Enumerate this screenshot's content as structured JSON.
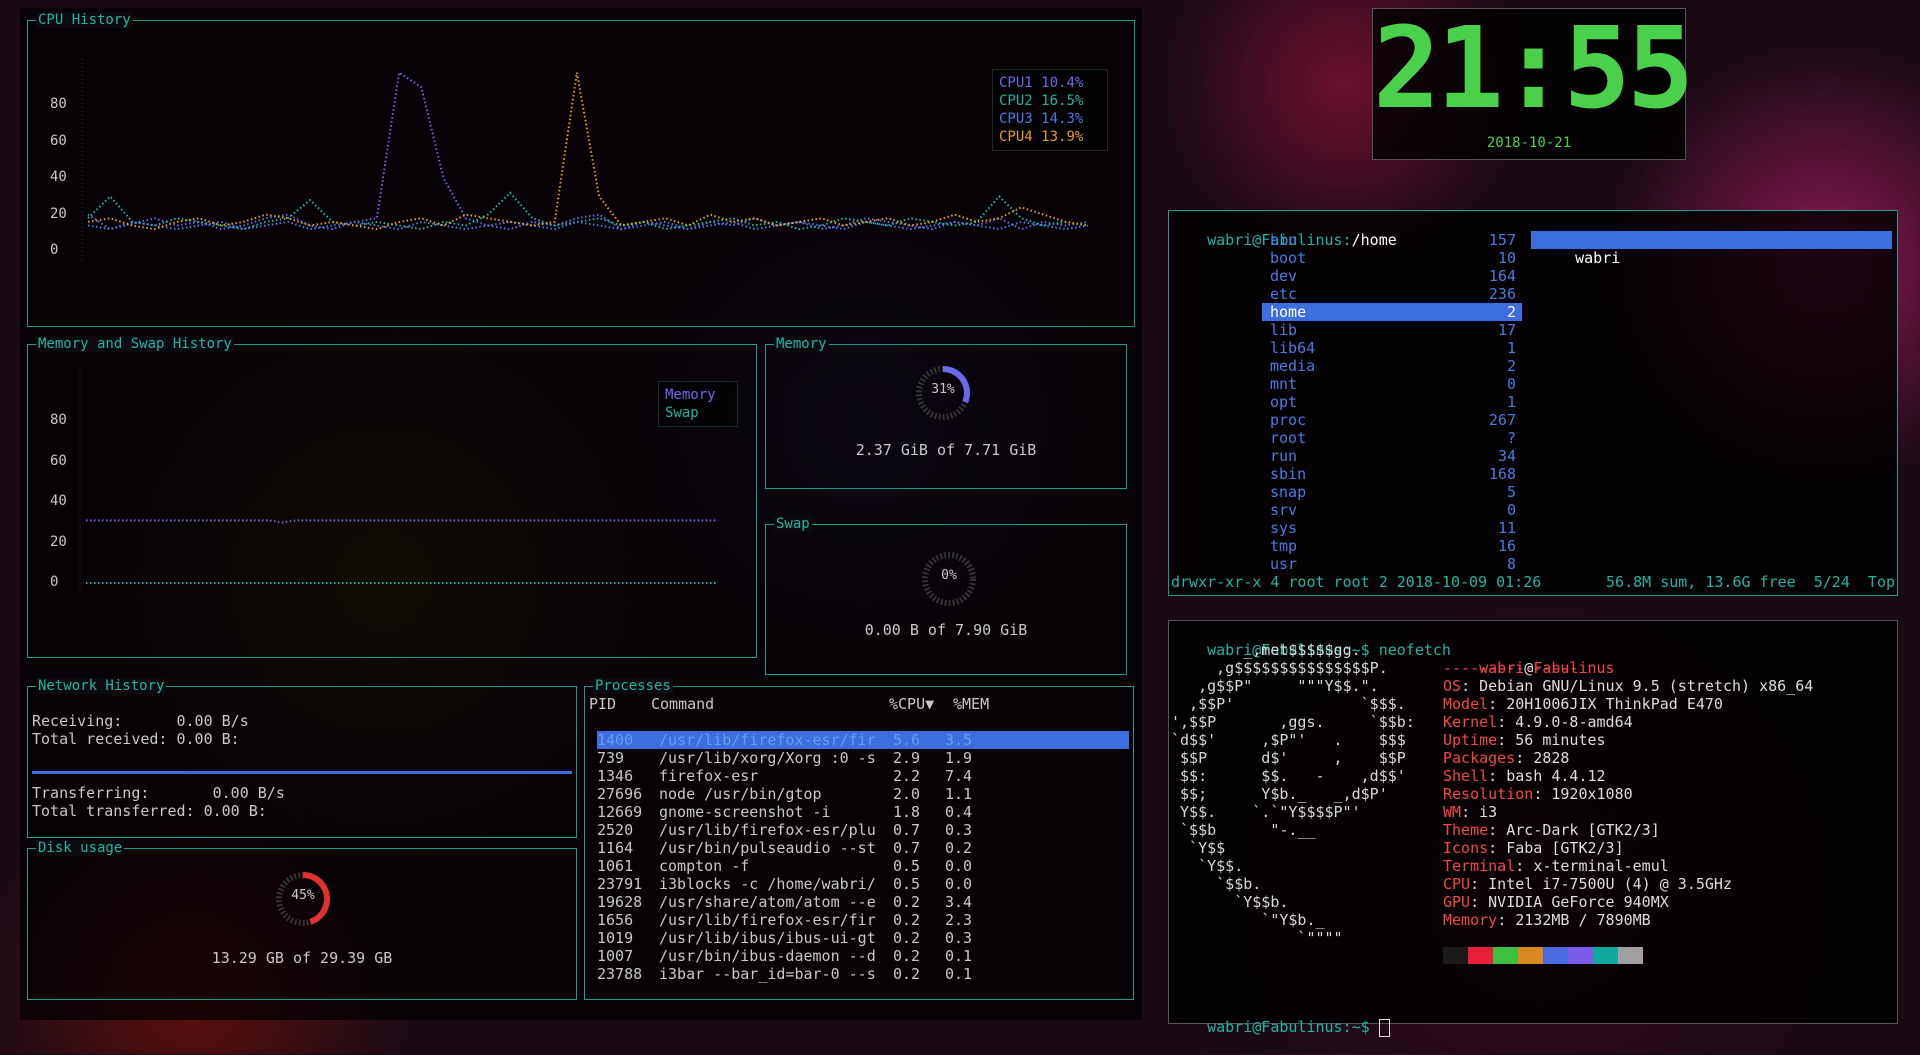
{
  "colors": {
    "accent": "#1fb5a2",
    "cpu1": "#6a6ae8",
    "cpu2": "#1fb5a2",
    "cpu3": "#4a7ae0",
    "cpu4": "#e0a020",
    "select": "#3d6ee0",
    "clock": "#4bd04b",
    "neofetch": "#f04848"
  },
  "cpu_history": {
    "title": "CPU History",
    "chart_data": {
      "type": "line",
      "title": "CPU History",
      "yticks": [
        80,
        60,
        40,
        20,
        0
      ],
      "ylim": [
        0,
        100
      ],
      "series": [
        {
          "name": "CPU1",
          "current": "10.4%",
          "values": [
            20,
            12,
            15,
            18,
            14,
            16,
            12,
            14,
            18,
            20,
            14,
            12,
            16,
            18,
            98,
            90,
            40,
            18,
            14,
            12,
            16,
            14,
            18,
            20,
            12,
            16,
            14,
            12,
            16,
            14,
            18,
            14,
            16,
            12,
            14,
            18,
            16,
            14,
            12,
            16,
            14,
            18,
            12,
            16,
            14,
            16
          ]
        },
        {
          "name": "CPU2",
          "current": "16.5%",
          "values": [
            18,
            30,
            16,
            14,
            18,
            16,
            14,
            12,
            16,
            18,
            28,
            16,
            14,
            16,
            14,
            12,
            16,
            14,
            20,
            32,
            18,
            14,
            16,
            18,
            14,
            16,
            12,
            14,
            16,
            18,
            14,
            16,
            12,
            14,
            18,
            16,
            14,
            18,
            16,
            14,
            16,
            30,
            18,
            14,
            16,
            14
          ]
        },
        {
          "name": "CPU3",
          "current": "14.3%",
          "values": [
            14,
            12,
            16,
            14,
            12,
            14,
            16,
            12,
            14,
            16,
            12,
            14,
            16,
            14,
            12,
            16,
            14,
            12,
            14,
            16,
            14,
            12,
            16,
            14,
            12,
            14,
            16,
            12,
            14,
            16,
            12,
            14,
            16,
            14,
            12,
            16,
            14,
            12,
            14,
            16,
            14,
            12,
            16,
            14,
            12,
            14
          ]
        },
        {
          "name": "CPU4",
          "current": "13.9%",
          "values": [
            16,
            18,
            14,
            12,
            16,
            18,
            14,
            16,
            20,
            18,
            14,
            16,
            14,
            12,
            16,
            18,
            14,
            20,
            18,
            16,
            14,
            16,
            98,
            30,
            14,
            16,
            18,
            14,
            20,
            16,
            18,
            14,
            16,
            18,
            14,
            16,
            18,
            14,
            16,
            20,
            16,
            18,
            24,
            20,
            16,
            14
          ]
        }
      ]
    }
  },
  "mem_history": {
    "title": "Memory and Swap History",
    "chart_data": {
      "type": "line",
      "title": "Memory and Swap History",
      "yticks": [
        80,
        60,
        40,
        20,
        0
      ],
      "ylim": [
        0,
        100
      ],
      "series": [
        {
          "name": "Memory",
          "values": [
            31,
            31,
            31,
            31,
            31,
            31,
            31,
            31,
            31,
            31,
            31,
            31,
            31,
            31,
            30,
            31,
            31,
            31,
            31,
            31,
            31,
            31,
            31,
            31,
            31,
            31,
            31,
            31,
            31,
            31,
            31,
            31,
            31,
            31,
            31,
            31,
            31,
            31,
            31,
            31,
            31,
            31,
            31,
            31,
            31,
            31
          ]
        },
        {
          "name": "Swap",
          "values": [
            0,
            0,
            0,
            0,
            0,
            0,
            0,
            0,
            0,
            0,
            0,
            0,
            0,
            0,
            0,
            0,
            0,
            0,
            0,
            0,
            0,
            0,
            0,
            0,
            0,
            0,
            0,
            0,
            0,
            0,
            0,
            0,
            0,
            0,
            0,
            0,
            0,
            0,
            0,
            0,
            0,
            0,
            0,
            0,
            0,
            0
          ]
        }
      ]
    }
  },
  "memory": {
    "title": "Memory",
    "percent": "31%",
    "fraction": 0.31,
    "detail": "2.37 GiB of 7.71 GiB"
  },
  "swap": {
    "title": "Swap",
    "percent": "0%",
    "fraction": 0,
    "detail": "0.00 B of 7.90 GiB"
  },
  "network": {
    "title": "Network History",
    "receiving": "Receiving:      0.00 B/s",
    "total_received": "Total received: 0.00 B:",
    "transferring": "Transferring:       0.00 B/s",
    "total_transferred": "Total transferred: 0.00 B:"
  },
  "disk": {
    "title": "Disk usage",
    "percent": "45%",
    "fraction": 0.45,
    "detail": "13.29 GB of 29.39 GB"
  },
  "processes": {
    "title": "Processes",
    "headers": {
      "pid": "PID",
      "command": "Command",
      "cpu": "%CPU▼",
      "mem": "%MEM"
    },
    "rows": [
      {
        "pid": "1400",
        "command": "/usr/lib/firefox-esr/fir",
        "cpu": "5.6",
        "mem": "3.5"
      },
      {
        "pid": "739",
        "command": "/usr/lib/xorg/Xorg :0 -s",
        "cpu": "2.9",
        "mem": "1.9"
      },
      {
        "pid": "1346",
        "command": "firefox-esr",
        "cpu": "2.2",
        "mem": "7.4"
      },
      {
        "pid": "27696",
        "command": "node /usr/bin/gtop",
        "cpu": "2.0",
        "mem": "1.1"
      },
      {
        "pid": "12669",
        "command": "gnome-screenshot -i",
        "cpu": "1.8",
        "mem": "0.4"
      },
      {
        "pid": "2520",
        "command": "/usr/lib/firefox-esr/plu",
        "cpu": "0.7",
        "mem": "0.3"
      },
      {
        "pid": "1164",
        "command": "/usr/bin/pulseaudio --st",
        "cpu": "0.7",
        "mem": "0.2"
      },
      {
        "pid": "1061",
        "command": "compton -f",
        "cpu": "0.5",
        "mem": "0.0"
      },
      {
        "pid": "23791",
        "command": "i3blocks -c /home/wabri/",
        "cpu": "0.5",
        "mem": "0.0"
      },
      {
        "pid": "19628",
        "command": "/usr/share/atom/atom --e",
        "cpu": "0.2",
        "mem": "3.4"
      },
      {
        "pid": "1656",
        "command": "/usr/lib/firefox-esr/fir",
        "cpu": "0.2",
        "mem": "2.3"
      },
      {
        "pid": "1019",
        "command": "/usr/lib/ibus/ibus-ui-gt",
        "cpu": "0.2",
        "mem": "0.3"
      },
      {
        "pid": "1007",
        "command": "/usr/bin/ibus-daemon --d",
        "cpu": "0.2",
        "mem": "0.1"
      },
      {
        "pid": "23788",
        "command": "i3bar --bar_id=bar-0 --s",
        "cpu": "0.2",
        "mem": "0.1"
      }
    ]
  },
  "clock": {
    "time": "21:55",
    "date": "2018-10-21"
  },
  "ranger": {
    "path_user": "wabri@Fabulinus:",
    "path_dir": "/home",
    "entries": [
      {
        "name": "bin",
        "count": "157"
      },
      {
        "name": "boot",
        "count": "10"
      },
      {
        "name": "dev",
        "count": "164"
      },
      {
        "name": "etc",
        "count": "236"
      },
      {
        "name": "home",
        "count": "2"
      },
      {
        "name": "lib",
        "count": "17"
      },
      {
        "name": "lib64",
        "count": "1"
      },
      {
        "name": "media",
        "count": "2"
      },
      {
        "name": "mnt",
        "count": "0"
      },
      {
        "name": "opt",
        "count": "1"
      },
      {
        "name": "proc",
        "count": "267"
      },
      {
        "name": "root",
        "count": "?"
      },
      {
        "name": "run",
        "count": "34"
      },
      {
        "name": "sbin",
        "count": "168"
      },
      {
        "name": "snap",
        "count": "5"
      },
      {
        "name": "srv",
        "count": "0"
      },
      {
        "name": "sys",
        "count": "11"
      },
      {
        "name": "tmp",
        "count": "16"
      },
      {
        "name": "usr",
        "count": "8"
      }
    ],
    "preview_entry": "wabri",
    "status_left": "drwxr-xr-x 4 root root 2 2018-10-09 01:26",
    "status_right": "56.8M sum, 13.6G free  5/24  Top"
  },
  "neofetch": {
    "prompt": "wabri@Fabulinus:~$ neofetch",
    "logo": [
      "        _,met$$$$$gg.",
      "     ,g$$$$$$$$$$$$$$$P.",
      "   ,g$$P\"     \"\"\"Y$$.\".",
      "  ,$$P'              `$$$.",
      "',$$P       ,ggs.     `$$b:",
      "`d$$'     ,$P\"'   .    $$$",
      " $$P      d$'     ,    $$P",
      " $$:      $$.   -    ,d$$'",
      " $$;      Y$b._   _,d$P'",
      " Y$$.    `.`\"Y$$$$P\"'",
      " `$$b      \"-.__",
      "  `Y$$",
      "   `Y$$.",
      "     `$$b.",
      "       `Y$$b.",
      "          `\"Y$b._",
      "              `\"\"\"\""
    ],
    "user": "wabri",
    "at": "@",
    "host": "Fabulinus",
    "separator": "---------------",
    "info": [
      {
        "key": "OS",
        "value": "Debian GNU/Linux 9.5 (stretch) x86_64"
      },
      {
        "key": "Model",
        "value": "20H1006JIX ThinkPad E470"
      },
      {
        "key": "Kernel",
        "value": "4.9.0-8-amd64"
      },
      {
        "key": "Uptime",
        "value": "56 minutes"
      },
      {
        "key": "Packages",
        "value": "2828"
      },
      {
        "key": "Shell",
        "value": "bash 4.4.12"
      },
      {
        "key": "Resolution",
        "value": "1920x1080"
      },
      {
        "key": "WM",
        "value": "i3"
      },
      {
        "key": "Theme",
        "value": "Arc-Dark [GTK2/3]"
      },
      {
        "key": "Icons",
        "value": "Faba [GTK2/3]"
      },
      {
        "key": "Terminal",
        "value": "x-terminal-emul"
      },
      {
        "key": "CPU",
        "value": "Intel i7-7500U (4) @ 3.5GHz"
      },
      {
        "key": "GPU",
        "value": "NVIDIA GeForce 940MX"
      },
      {
        "key": "Memory",
        "value": "2132MB / 7890MB"
      }
    ],
    "palette": [
      "#1a1a1a",
      "#e8203a",
      "#3fbf3f",
      "#d88a20",
      "#4a6ae0",
      "#7a5ae8",
      "#12a8a0",
      "#a0a0a0"
    ],
    "prompt2": "wabri@Fabulinus:~$"
  }
}
